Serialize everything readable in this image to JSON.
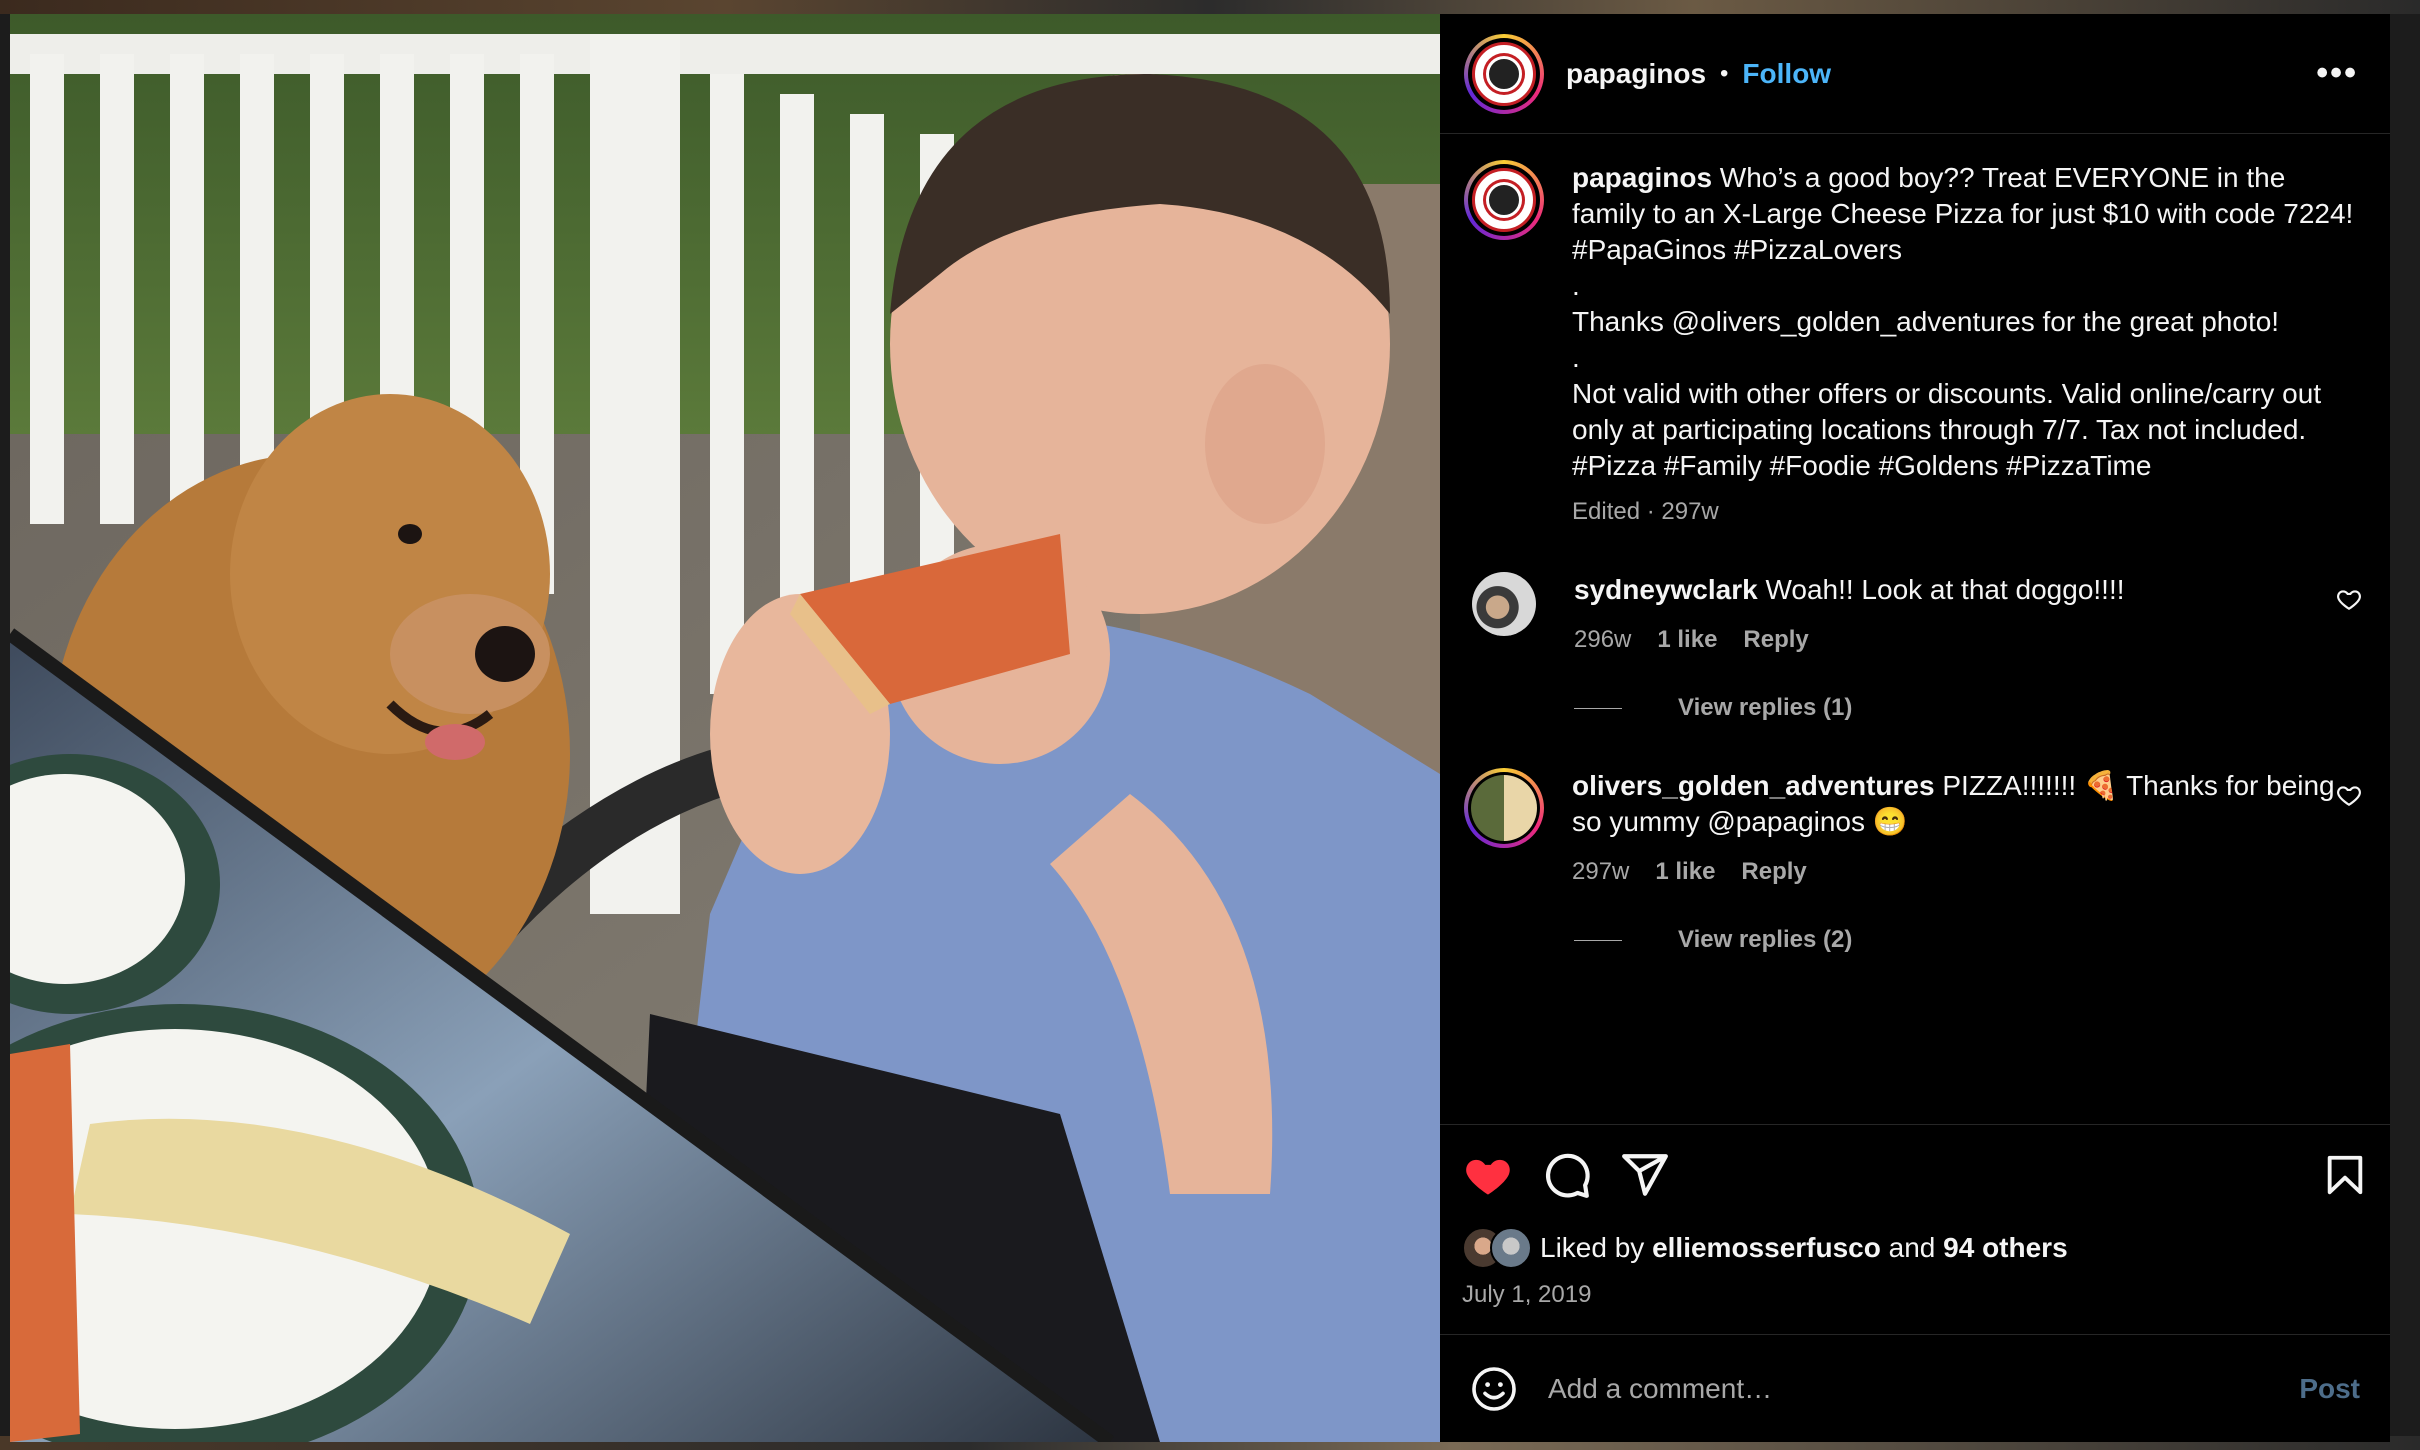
{
  "post": {
    "username": "papaginos",
    "follow_label": "Follow",
    "more_label": "•••",
    "caption": "Who’s a good boy?? Treat EVERYONE in the family to an X-Large Cheese Pizza for just $10 with code 7224! #PapaGinos #PizzaLovers\n.\nThanks @olivers_golden_adventures for the great photo!\n.\nNot valid with other offers or discounts. Valid online/carry out only at participating locations through 7/7. Tax not included.\n#Pizza #Family #Foodie #Goldens #PizzaTime",
    "caption_meta": "Edited · 297w"
  },
  "comments": [
    {
      "username": "sydneywclark",
      "text": "Woah!! Look at that doggo!!!!",
      "time": "296w",
      "likes": "1 like",
      "reply_label": "Reply",
      "view_replies": "View replies (1)"
    },
    {
      "username": "olivers_golden_adventures",
      "text": "PIZZA!!!!!!! 🍕 Thanks for being so yummy @papaginos 😁",
      "time": "297w",
      "likes": "1 like",
      "reply_label": "Reply",
      "view_replies": "View replies (2)"
    }
  ],
  "likes": {
    "prefix": "Liked by",
    "user": "elliemosserfusco",
    "and": "and",
    "others": "94 others"
  },
  "date": "July 1, 2019",
  "add_comment": {
    "placeholder": "Add a comment…",
    "post_label": "Post"
  },
  "colors": {
    "accent_blue": "#4cb5f9",
    "like_red": "#ff3040",
    "muted": "#a8a8a8"
  },
  "icons": [
    "heart-icon",
    "comment-icon",
    "share-icon",
    "bookmark-icon",
    "emoji-icon",
    "more-icon"
  ]
}
